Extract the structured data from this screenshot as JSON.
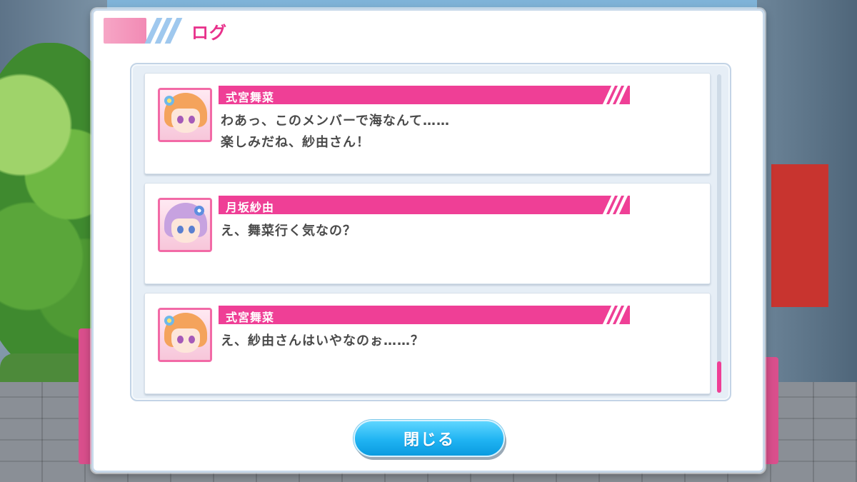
{
  "header": {
    "title": "ログ"
  },
  "log_entries": [
    {
      "speaker": "式宮舞菜",
      "lines": [
        "わあっ、このメンバーで海なんて……",
        "楽しみだね、紗由さん！"
      ],
      "avatar_icon": "maina-portrait-icon"
    },
    {
      "speaker": "月坂紗由",
      "lines": [
        "え、舞菜行く気なの？"
      ],
      "avatar_icon": "sayu-portrait-icon"
    },
    {
      "speaker": "式宮舞菜",
      "lines": [
        "え、紗由さんはいやなのぉ……？"
      ],
      "avatar_icon": "maina-portrait-icon"
    }
  ],
  "scrollbar": {
    "position": "bottom",
    "scroll_fraction": 1.0
  },
  "close_button": {
    "label": "閉じる"
  },
  "colors": {
    "accent_pink": "#ef3f96",
    "title_pink": "#e8308b",
    "button_blue": "#1fb3f2",
    "text_dark": "#4a4a4a"
  }
}
